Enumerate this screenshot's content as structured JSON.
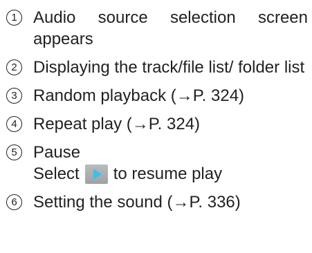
{
  "items": [
    {
      "num": "1",
      "text": "Audio source selection screen appears"
    },
    {
      "num": "2",
      "text": "Displaying the track/file list/ folder list"
    },
    {
      "num": "3",
      "text": "Random playback (→P. 324)"
    },
    {
      "num": "4",
      "text": "Repeat play (→P. 324)"
    },
    {
      "num": "5",
      "text": "Pause",
      "sub_before": "Select",
      "sub_after": "to resume play",
      "icon": "play-icon"
    },
    {
      "num": "6",
      "text": "Setting the sound (→P. 336)"
    }
  ]
}
